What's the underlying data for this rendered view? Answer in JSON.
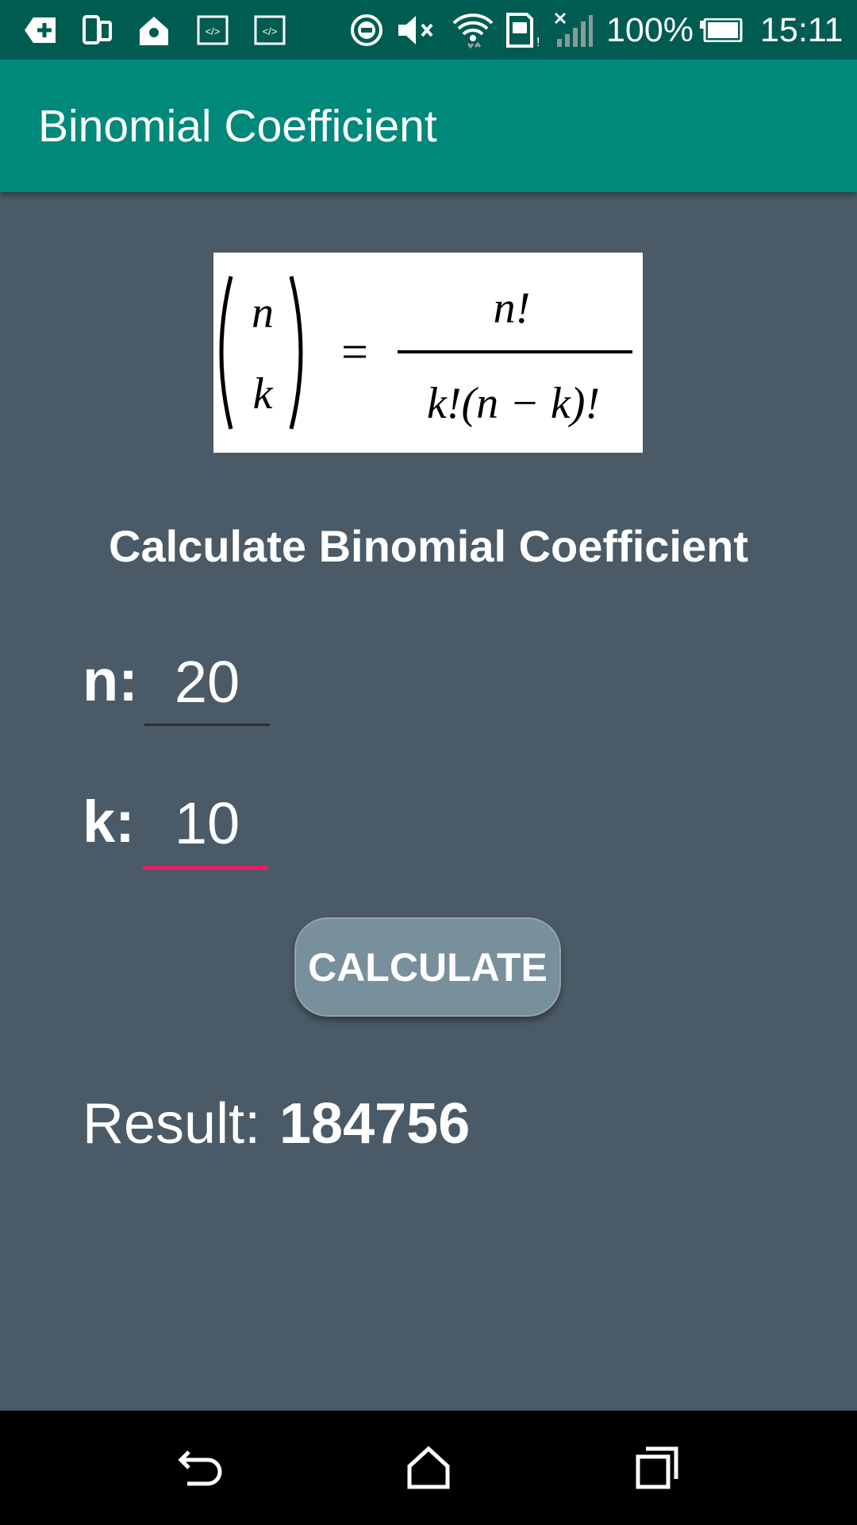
{
  "status_bar": {
    "battery_percent": "100%",
    "time": "15:11",
    "icons": [
      "add-notification-icon",
      "device-icon",
      "location-icon",
      "code-icon",
      "code-icon",
      "do-not-disturb-icon",
      "mute-icon",
      "wifi-icon",
      "sim-card-icon",
      "signal-off-icon",
      "battery-icon"
    ]
  },
  "app_bar": {
    "title": "Binomial Coefficient"
  },
  "formula": {
    "top": "n",
    "bottom": "k",
    "equals": "=",
    "numerator": "n!",
    "denominator": "k!(n − k)!"
  },
  "heading": "Calculate Binomial Coefficient",
  "fields": {
    "n": {
      "label": "n:",
      "value": "20"
    },
    "k": {
      "label": "k:",
      "value": "10"
    }
  },
  "calculate_button": {
    "label": "CALCULATE"
  },
  "result": {
    "label": "Result:",
    "value": "184756"
  },
  "nav_bar": {
    "icons": [
      "back-icon",
      "home-icon",
      "recents-icon"
    ]
  },
  "colors": {
    "status_bar": "#005c51",
    "app_bar": "#00897b",
    "background": "#4a5a66",
    "accent": "#e91e63",
    "button": "#78909c"
  }
}
